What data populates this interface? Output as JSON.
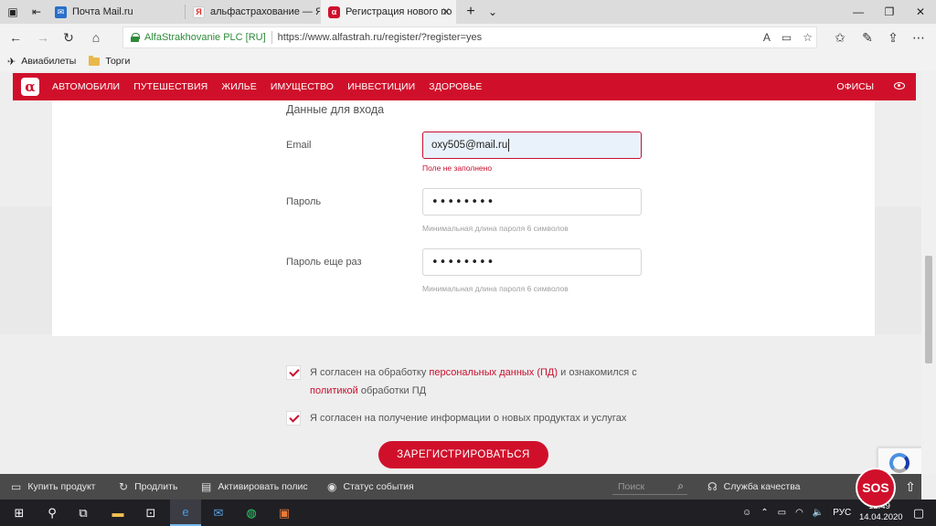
{
  "browser": {
    "tabs": [
      {
        "label": "Почта Mail.ru"
      },
      {
        "label": "альфастрахование — Янде"
      },
      {
        "label": "Регистрация нового по"
      }
    ],
    "cert_name": "AlfaStrakhovanie PLC [RU]",
    "url": "https://www.alfastrah.ru/register/?register=yes",
    "favorites": [
      "Авиабилеты",
      "Торги"
    ]
  },
  "site_header": {
    "logo": "α",
    "menu": [
      "АВТОМОБИЛИ",
      "ПУТЕШЕСТВИЯ",
      "ЖИЛЬЕ",
      "ИМУЩЕСТВО",
      "ИНВЕСТИЦИИ",
      "ЗДОРОВЬЕ"
    ],
    "offices": "ОФИСЫ"
  },
  "form": {
    "section_title": "Данные для входа",
    "email_label": "Email",
    "email_value": "oxy505@mail.ru",
    "email_error": "Поле не заполнено",
    "password_label": "Пароль",
    "password_value": "••••••••",
    "password_hint": "Минимальная длина пароля 6 символов",
    "password2_label": "Пароль еще раз",
    "password2_value": "••••••••",
    "password2_hint": "Минимальная длина пароля 6 символов"
  },
  "agreements": {
    "a1_part1": "Я согласен на обработку ",
    "a1_link1": "персональных данных (ПД)",
    "a1_part2": " и ознакомился с",
    "a1_link2": "политикой",
    "a1_part3": " обработки ПД",
    "a2": "Я согласен на получение информации о новых продуктах и услугах"
  },
  "register_button": "ЗАРЕГИСТРИРОВАТЬСЯ",
  "bottom_bar": {
    "buy": "Купить продукт",
    "renew": "Продлить",
    "activate": "Активировать полис",
    "status": "Статус события",
    "search_placeholder": "Поиск",
    "quality": "Служба качества",
    "sos": "SOS"
  },
  "taskbar": {
    "lang": "РУС",
    "time": "12:49",
    "date": "14.04.2020"
  },
  "colors": {
    "brand_red": "#d0102b",
    "cert_green": "#2e8b3a"
  }
}
